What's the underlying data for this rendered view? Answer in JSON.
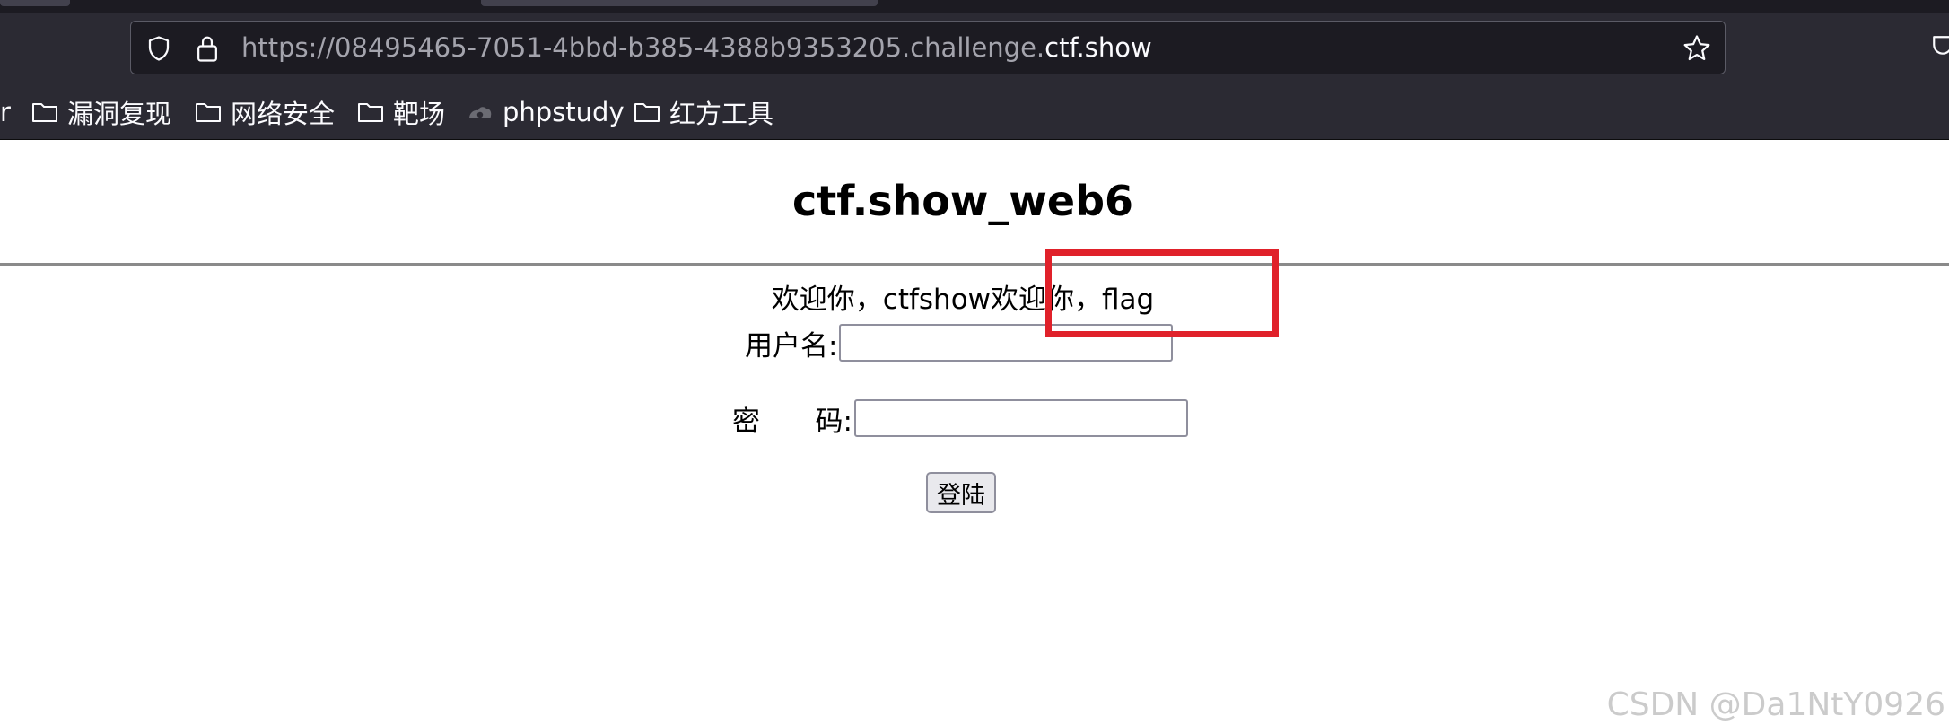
{
  "browser": {
    "url_dim_part": "https://08495465-7051-4bbd-b385-4388b9353205.challenge.",
    "url_domain_part": "ctf.show"
  },
  "bookmarks": {
    "cutoff_label": "r",
    "items": [
      {
        "label": "漏洞复现",
        "icon": "folder-icon"
      },
      {
        "label": "网络安全",
        "icon": "folder-icon"
      },
      {
        "label": "靶场",
        "icon": "folder-icon"
      },
      {
        "label": "phpstudy",
        "icon": "site-favicon-icon"
      },
      {
        "label": "红方工具",
        "icon": "folder-icon"
      }
    ]
  },
  "page": {
    "title": "ctf.show_web6",
    "welcome_text": "欢迎你，ctfshow欢迎你，flag",
    "username_label": "用户名:",
    "password_label_a": "密",
    "password_label_b": "码:",
    "username_value": "",
    "password_value": "",
    "login_button": "登陆"
  },
  "watermark": "CSDN @Da1NtY0926",
  "colors": {
    "chrome_bg": "#2b2a33",
    "urlbar_bg": "#1c1b22",
    "annotation_red": "#e0212a"
  }
}
